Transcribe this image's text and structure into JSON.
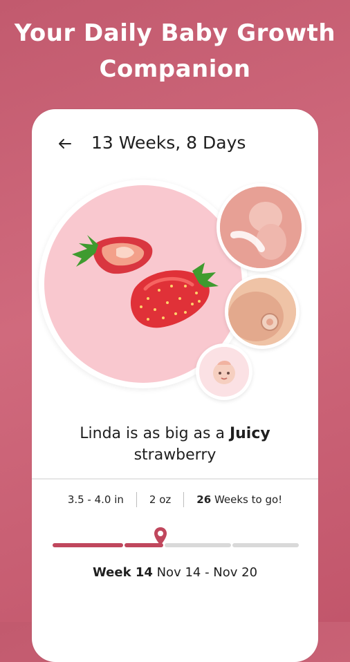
{
  "headline": {
    "line1": "Your Daily Baby Growth",
    "line2": "Companion"
  },
  "header": {
    "back_icon": "arrow-left-icon",
    "title": "13 Weeks, 8 Days"
  },
  "illustrations": {
    "main": "strawberry-illustration",
    "thumb1": "fetus-image",
    "thumb2": "belly-image",
    "thumb3": "baby-face-icon"
  },
  "size_caption": {
    "prefix": "Linda is as big as a ",
    "highlight_1": "Juicy",
    "highlight_2": "strawberry"
  },
  "stats": {
    "length": "3.5 - 4.0 in",
    "weight": "2 oz",
    "weeks_remaining_number": "26",
    "weeks_remaining_text": " Weeks to go!"
  },
  "timeline": {
    "progress_fraction": 0.43,
    "pin_icon": "location-pin-icon"
  },
  "week_range": {
    "week_label": "Week 14",
    "dates": " Nov 14 - Nov 20"
  },
  "colors": {
    "background": "#c85f72",
    "accent": "#c0475d",
    "circle_fill": "#f9c8cf"
  }
}
